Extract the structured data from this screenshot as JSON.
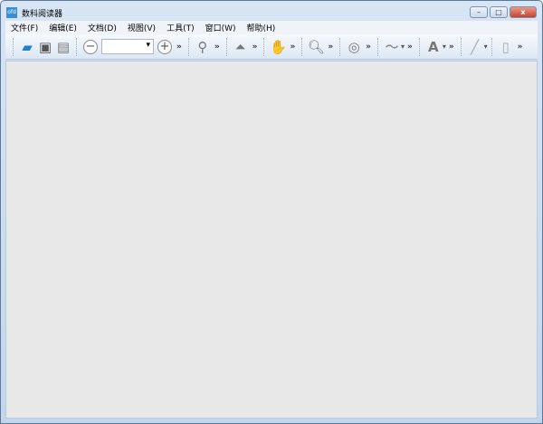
{
  "window": {
    "title": "数科阅读器",
    "app_icon": "ofd"
  },
  "controls": {
    "minimize": "–",
    "maximize": "□",
    "close": "x"
  },
  "menu": [
    "文件(F)",
    "编辑(E)",
    "文档(D)",
    "视图(V)",
    "工具(T)",
    "窗口(W)",
    "帮助(H)"
  ],
  "toolbar": {
    "zoom_value": "",
    "more": "»",
    "zoom_out": "−",
    "zoom_in": "+"
  }
}
